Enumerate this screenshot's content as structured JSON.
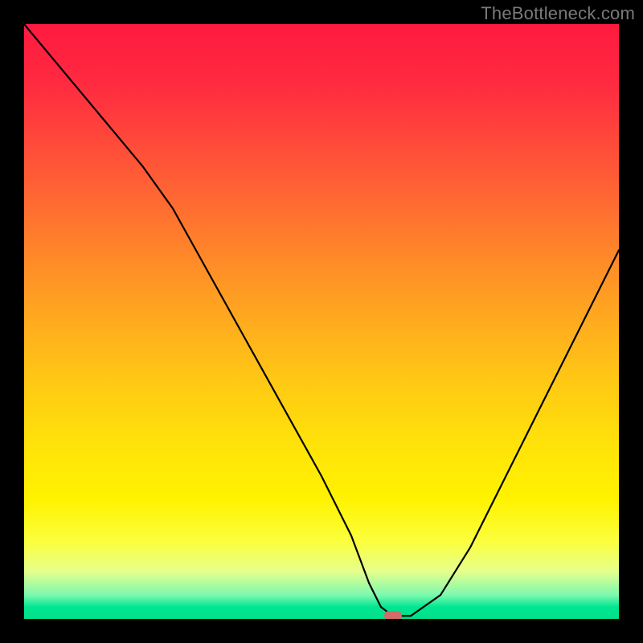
{
  "attribution": "TheBottleneck.com",
  "colors": {
    "frame": "#000000",
    "curve": "#000000",
    "marker": "#d46a6a",
    "gradient_top": "#ff1a3f",
    "gradient_mid": "#ffd400",
    "gradient_bottom": "#00e08a"
  },
  "chart_data": {
    "type": "line",
    "title": "",
    "xlabel": "",
    "ylabel": "",
    "xlim": [
      0,
      100
    ],
    "ylim": [
      0,
      100
    ],
    "x": [
      0,
      5,
      10,
      15,
      20,
      25,
      30,
      35,
      40,
      45,
      50,
      55,
      58,
      60,
      62,
      65,
      70,
      75,
      80,
      85,
      90,
      95,
      100
    ],
    "y": [
      100,
      94,
      88,
      82,
      76,
      69,
      60,
      51,
      42,
      33,
      24,
      14,
      6,
      2,
      0.5,
      0.5,
      4,
      12,
      22,
      32,
      42,
      52,
      62
    ],
    "marker": {
      "x": 62,
      "y": 0.5
    },
    "note": "Curve descends steeply from top-left, bottoms out near x≈62 at y≈0, then rises to about y≈62 at right edge. Values are estimated fractions of plot height (0 = bottom, 100 = top)."
  }
}
